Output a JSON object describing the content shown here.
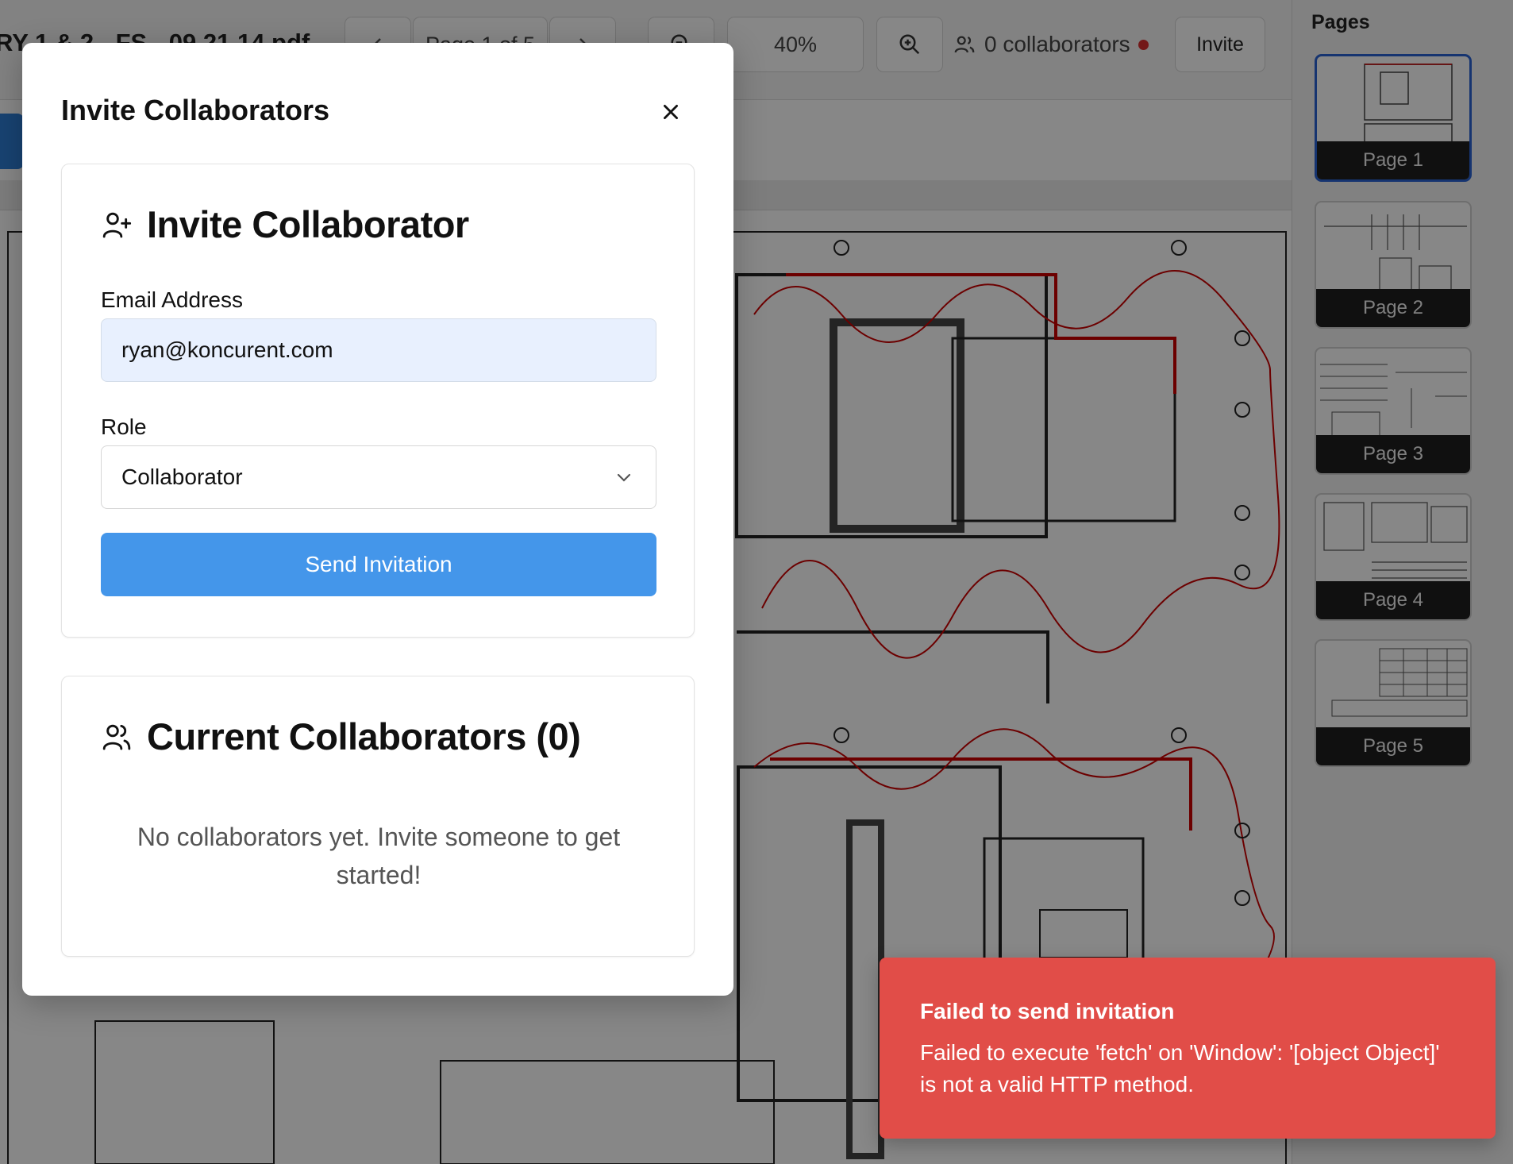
{
  "toolbar": {
    "filename": "RY 1 & 2 - FS - 09.21.14.pdf",
    "page_indicator": "Page 1 of 5",
    "zoom_level": "40%",
    "collaborators_status": "0 collaborators",
    "invite_label": "Invite"
  },
  "sidebar": {
    "title": "Pages",
    "pages": [
      "Page 1",
      "Page 2",
      "Page 3",
      "Page 4",
      "Page 5"
    ],
    "active_page": "Page 1"
  },
  "modal": {
    "title": "Invite Collaborators",
    "invite_card": {
      "heading": "Invite Collaborator",
      "email_label": "Email Address",
      "email_value": "ryan@koncurent.com",
      "role_label": "Role",
      "role_value": "Collaborator",
      "send_label": "Send Invitation"
    },
    "current_card": {
      "heading": "Current Collaborators (0)",
      "empty_text": "No collaborators yet. Invite someone to get started!"
    }
  },
  "toast": {
    "title": "Failed to send invitation",
    "message": "Failed to execute 'fetch' on 'Window': '[object Object]' is not a valid HTTP method."
  },
  "colors": {
    "accent": "#4496ea",
    "toast_error": "#e14d48",
    "active_thumb_border": "#2a63d3",
    "status_dot": "#d93030"
  },
  "icons": {
    "close": "close-icon",
    "add_user": "user-plus-icon",
    "users": "users-icon",
    "chevron": "chevron-down-icon"
  }
}
